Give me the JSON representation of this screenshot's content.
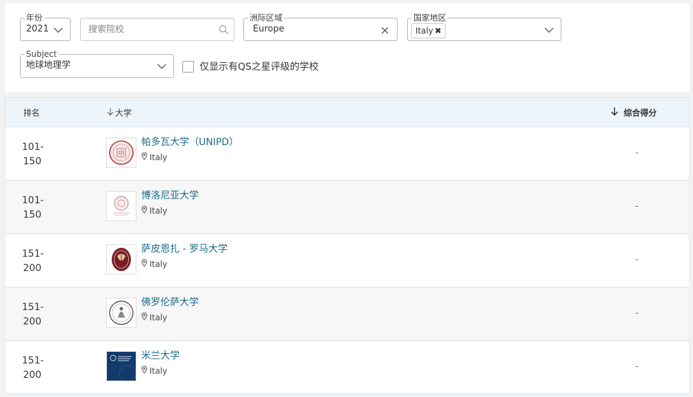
{
  "filters": {
    "year": {
      "legend": "年份",
      "value": "2021"
    },
    "search": {
      "placeholder": "搜索院校",
      "value": ""
    },
    "region": {
      "legend": "洲际区域",
      "value": "Europe"
    },
    "country": {
      "legend": "国家地区",
      "chip": "Italy",
      "chip_remove": "✖"
    },
    "subject": {
      "legend": "Subject",
      "value": "地球地理学"
    },
    "qs_stars_only": {
      "label": "仅显示有QS之星评级的学校",
      "checked": false
    }
  },
  "table": {
    "columns": {
      "rank": "排名",
      "university": "大学",
      "score": "综合得分"
    },
    "rows": [
      {
        "rank_line1": "101-",
        "rank_line2": "150",
        "name": "帕多瓦大学（UNIPD）",
        "location": "Italy",
        "score": "-",
        "logo": "padova-seal"
      },
      {
        "rank_line1": "101-",
        "rank_line2": "150",
        "name": "博洛尼亚大学",
        "location": "Italy",
        "score": "-",
        "logo": "bologna-seal"
      },
      {
        "rank_line1": "151-",
        "rank_line2": "200",
        "name": "萨皮恩扎 - 罗马大学",
        "location": "Italy",
        "score": "-",
        "logo": "sapienza-seal"
      },
      {
        "rank_line1": "151-",
        "rank_line2": "200",
        "name": "佛罗伦萨大学",
        "location": "Italy",
        "score": "-",
        "logo": "florence-seal"
      },
      {
        "rank_line1": "151-",
        "rank_line2": "200",
        "name": "米兰大学",
        "location": "Italy",
        "score": "-",
        "logo": "milan-logo"
      }
    ]
  },
  "colors": {
    "link": "#1a6c8a",
    "header_bg": "#edf5fb",
    "alt_row": "#f7f7f7"
  }
}
